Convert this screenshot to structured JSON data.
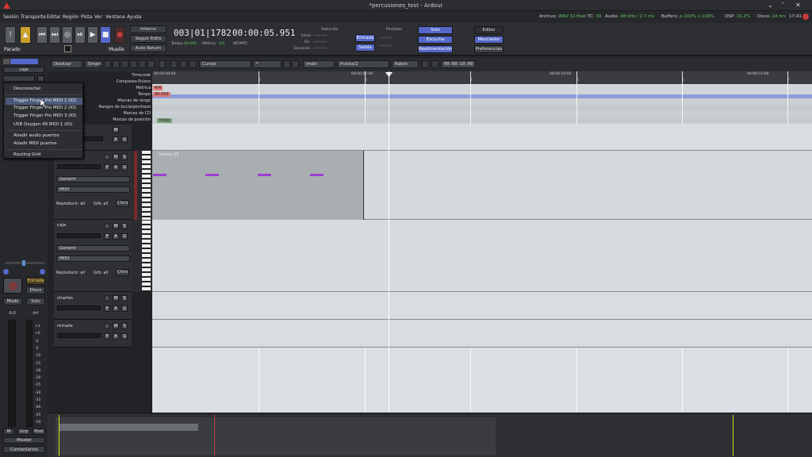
{
  "window": {
    "title": "*percusiones_test - Ardour",
    "logo": "ardour-logo"
  },
  "menu": [
    "Sesión",
    "Transporte",
    "Editar",
    "Región",
    "Pista",
    "Ver",
    "Ventana",
    "Ayuda"
  ],
  "status": {
    "archivo_label": "Archivo:",
    "archivo": "WAV 32-float",
    "tc_label": "TC:",
    "tc": "30",
    "audio_label": "Audio:",
    "audio": "48 kHz / 2.7 ms",
    "buffers_label": "Buffers:",
    "buffers": "p:100% c:100%",
    "dsp_label": "DSP:",
    "dsp": "10.2%",
    "disco_label": "Disco:",
    "disco": "24 hrs",
    "time": "17:41"
  },
  "transport": {
    "interno": "Interno",
    "seguir": "Seguir Edits",
    "auto_return": "Auto Return",
    "state": "Parado",
    "muelle": "Muelle"
  },
  "clocks": {
    "primary": "003|01|1782",
    "tempo_label": "Tempo",
    "tempo": "90.000",
    "metrica_label": "Métrica",
    "metrica": "4/4",
    "secondary": "00:00:05.951",
    "secondary_sub": "INT/MTC"
  },
  "range": {
    "seleccion": "Selección",
    "pinchazo": "Pinchazo",
    "inicio": "Inicio",
    "fin": "Fin",
    "duracion": "Duración",
    "placeholder": "--:--:--:--",
    "entrada": "Entrada",
    "salida": "Salida"
  },
  "monitor": {
    "solo": "Solo",
    "escucha": "Escucha",
    "realimentacion": "Realimentación"
  },
  "views": {
    "editor": "Editor",
    "mezclador": "Mezclador",
    "preferencias": "Preferencias"
  },
  "edit_toolbar": {
    "mode": "Deslizar",
    "smart": "Smart",
    "cursor": "Cursor",
    "ratio": "*",
    "iman": "Imán",
    "pulsos": "Pulsos/2",
    "raton": "Ratón",
    "nudge": "00:00:10:00"
  },
  "rulers": {
    "labels": [
      "Timecode",
      "Compases:Pulsos",
      "Métrica",
      "Tempo",
      "Marcas de rango",
      "Rangos de bucle/pinchazo",
      "Marcas de CD",
      "Marcas de posición"
    ],
    "tc_marks": [
      "00:00:00:00",
      "00:00:05:00",
      "00:00:10:00",
      "00:00:15:00"
    ],
    "bar_marks": [
      "2",
      "3",
      "4",
      "5",
      "6",
      "7"
    ],
    "meter": "4/4",
    "tempo": "90.000",
    "inicio": "Inicio"
  },
  "popup": {
    "items": [
      "Desconectar",
      "Trigger Finger Pro MIDI 1 (IO)",
      "Trigger Finger Pro MIDI 2 (IO)",
      "Trigger Finger Pro MIDI 3 (IO)",
      "USB Oxygen 49 MIDI 1 (IO)",
      "Añadir audio puertos",
      "Añadir MIDI puertos",
      "Routing Grid"
    ]
  },
  "strip": {
    "name": "caja",
    "entrada": "Entrada",
    "disco": "Disco",
    "mudo": "Mudo",
    "solo": "Solo",
    "gain": "-9,0",
    "peak": "-inf",
    "scale": [
      "+3",
      "+0",
      "-3",
      "-5",
      "-10",
      "-15",
      "-18",
      "-20",
      "-25",
      "-30",
      "-35",
      "-40",
      "-45",
      "-50"
    ],
    "m": "M",
    "grp": "Grp",
    "post": "Post",
    "master": "Master",
    "comentarios": "Comentarios"
  },
  "tracks": [
    {
      "name": "",
      "m": "M",
      "a": "A",
      "g": "G"
    },
    {
      "name": "bombo",
      "m": "M",
      "s": "S",
      "p": "P",
      "a": "A",
      "g": "G",
      "instr": "Generic",
      "mode": "MIDI",
      "play": "Reproducir: all",
      "rec": "Grb: all",
      "chns": "Chns",
      "region": "bombo-15"
    },
    {
      "name": "caja",
      "m": "M",
      "s": "S",
      "p": "P",
      "a": "A",
      "g": "G",
      "instr": "Generic",
      "mode": "MIDI",
      "play": "Reproducir: all",
      "rec": "Grb: all",
      "chns": "Chns"
    },
    {
      "name": "charles",
      "m": "M",
      "s": "S",
      "p": "P",
      "a": "A",
      "g": "G"
    },
    {
      "name": "remate",
      "m": "M",
      "s": "S",
      "p": "P",
      "a": "A",
      "g": "G"
    }
  ],
  "colors": {
    "note": "#9b3fd0",
    "accent_blue": "#5568c9",
    "record_red": "#c43c3c",
    "region": "#a9aeb1"
  }
}
